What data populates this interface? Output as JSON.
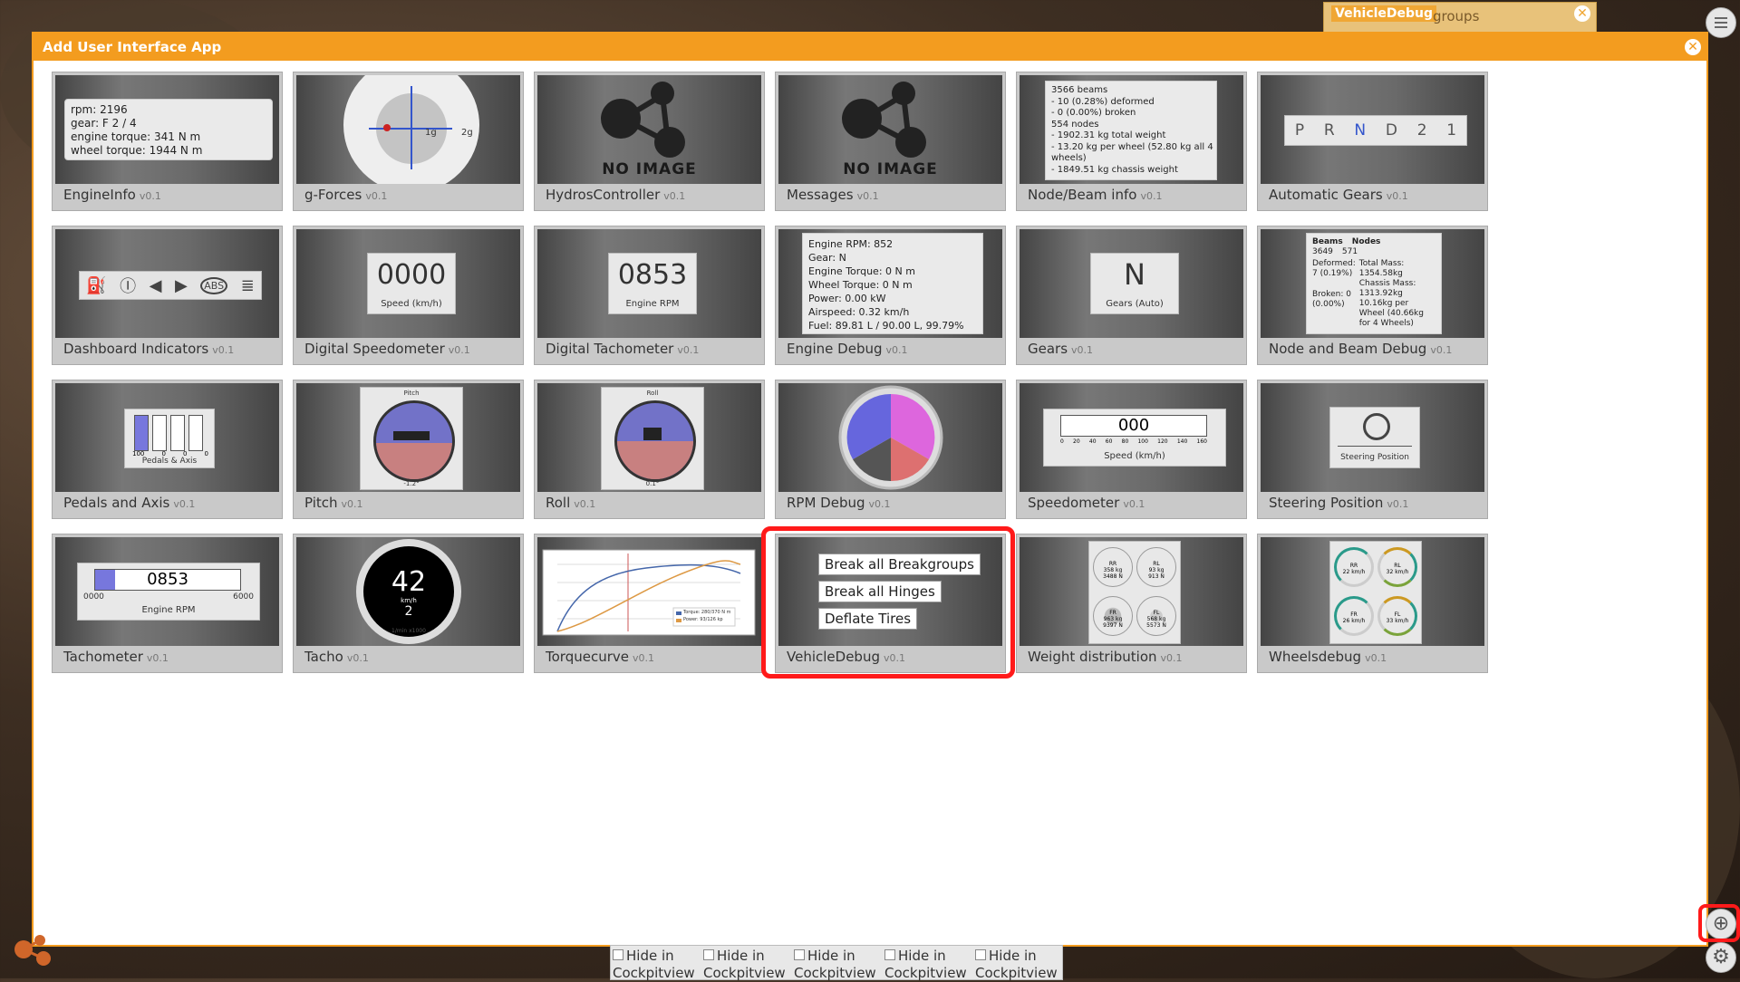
{
  "top_widget": {
    "title": "VehicleDebug",
    "rest": "groups"
  },
  "dialog": {
    "title": "Add User Interface App"
  },
  "apps": [
    {
      "name": "EngineInfo",
      "version": "v0.1"
    },
    {
      "name": "g-Forces",
      "version": "v0.1"
    },
    {
      "name": "HydrosController",
      "version": "v0.1"
    },
    {
      "name": "Messages",
      "version": "v0.1"
    },
    {
      "name": "Node/Beam info",
      "version": "v0.1"
    },
    {
      "name": "Automatic Gears",
      "version": "v0.1"
    },
    {
      "name": "Dashboard Indicators",
      "version": "v0.1"
    },
    {
      "name": "Digital Speedometer",
      "version": "v0.1"
    },
    {
      "name": "Digital Tachometer",
      "version": "v0.1"
    },
    {
      "name": "Engine Debug",
      "version": "v0.1"
    },
    {
      "name": "Gears",
      "version": "v0.1"
    },
    {
      "name": "Node and Beam Debug",
      "version": "v0.1"
    },
    {
      "name": "Pedals and Axis",
      "version": "v0.1"
    },
    {
      "name": "Pitch",
      "version": "v0.1"
    },
    {
      "name": "Roll",
      "version": "v0.1"
    },
    {
      "name": "RPM Debug",
      "version": "v0.1"
    },
    {
      "name": "Speedometer",
      "version": "v0.1"
    },
    {
      "name": "Steering Position",
      "version": "v0.1"
    },
    {
      "name": "Tachometer",
      "version": "v0.1"
    },
    {
      "name": "Tacho",
      "version": "v0.1"
    },
    {
      "name": "Torquecurve",
      "version": "v0.1"
    },
    {
      "name": "VehicleDebug",
      "version": "v0.1"
    },
    {
      "name": "Weight distribution",
      "version": "v0.1"
    },
    {
      "name": "Wheelsdebug",
      "version": "v0.1"
    }
  ],
  "previews": {
    "engineinfo": [
      "rpm: 2196",
      "gear: F 2 / 4",
      "engine torque: 341 N m",
      "wheel torque: 1944 N m"
    ],
    "gforces": {
      "g1": "1g",
      "g2": "2g"
    },
    "no_image": "NO IMAGE",
    "nodebeam": [
      "3566 beams",
      "- 10 (0.28%) deformed",
      "- 0 (0.00%) broken",
      "554 nodes",
      "- 1902.31 kg total weight",
      "- 13.20 kg per wheel (52.80 kg all 4",
      "wheels)",
      "- 1849.51 kg chassis weight"
    ],
    "autogears": [
      "P",
      "R",
      "N",
      "D",
      "2",
      "1"
    ],
    "digital_speedo": {
      "value": "0000",
      "label": "Speed (km/h)"
    },
    "digital_tacho": {
      "value": "0853",
      "label": "Engine RPM"
    },
    "engine_debug": [
      "Engine RPM: 852",
      "Gear: N",
      "Engine Torque: 0 N m",
      "Wheel Torque: 0 N m",
      "Power: 0.00 kW",
      "Airspeed: 0.32 km/h",
      "Fuel: 89.81 L / 90.00 L, 99.79%"
    ],
    "gears": {
      "value": "N",
      "label": "Gears (Auto)"
    },
    "nb_debug": {
      "col1": "Beams",
      "col2": "Nodes",
      "b_val": "3649",
      "n_val": "571",
      "deformed": "Deformed: 7 (0.19%)",
      "broken": "Broken: 0 (0.00%)",
      "total_mass": "Total Mass: 1354.58kg Chassis Mass: 1313.92kg",
      "per_wheel": "10.16kg per Wheel (40.66kg for 4 Wheels)"
    },
    "pedals": {
      "label": "Pedals & Axis",
      "values": [
        "100",
        "0",
        "0",
        "0"
      ]
    },
    "pitch": {
      "title": "Pitch",
      "value": "-1.2°"
    },
    "roll": {
      "title": "Roll",
      "value": "0.1°"
    },
    "speedometer": {
      "value": "000",
      "label": "Speed (km/h)",
      "ticks": [
        "0",
        "20",
        "40",
        "60",
        "80",
        "100",
        "120",
        "140",
        "160"
      ]
    },
    "steering": {
      "label": "Steering Position"
    },
    "tachometer": {
      "value": "0853",
      "min": "0000",
      "max": "6000",
      "label": "Engine RPM"
    },
    "tacho": {
      "value": "42",
      "unit": "km/h",
      "gear": "2",
      "sub": "1/min x1000"
    },
    "torque": {
      "legend1": "Torque: 280/370 N m",
      "legend2": "Power: 93/126 kp"
    },
    "vehicledebug": {
      "btn1": "Break all Breakgroups",
      "btn2": "Break all Hinges",
      "btn3": "Deflate Tires"
    },
    "weight": [
      [
        "RR",
        "358 kg",
        "3488 N"
      ],
      [
        "RL",
        "93 kg",
        "913 N"
      ],
      [
        "FR",
        "963 kg",
        "9397 N"
      ],
      [
        "FL",
        "568 kg",
        "5573 N"
      ]
    ],
    "wheels": [
      [
        "RR",
        "22 km/h"
      ],
      [
        "RL",
        "32 km/h"
      ],
      [
        "FR",
        "26 km/h"
      ],
      [
        "FL",
        "33 km/h"
      ]
    ]
  },
  "bottom_bar": {
    "options": [
      {
        "line1": "Hide in",
        "line2": "Cockpitview"
      },
      {
        "line1": "Hide in",
        "line2": "Cockpitview"
      },
      {
        "line1": "Hide in",
        "line2": "Cockpitview"
      },
      {
        "line1": "Hide in",
        "line2": "Cockpitview"
      },
      {
        "line1": "Hide in",
        "line2": "Cockpitview"
      }
    ]
  },
  "colors": {
    "accent": "#f39c1f",
    "highlight": "#ff1a1a"
  }
}
